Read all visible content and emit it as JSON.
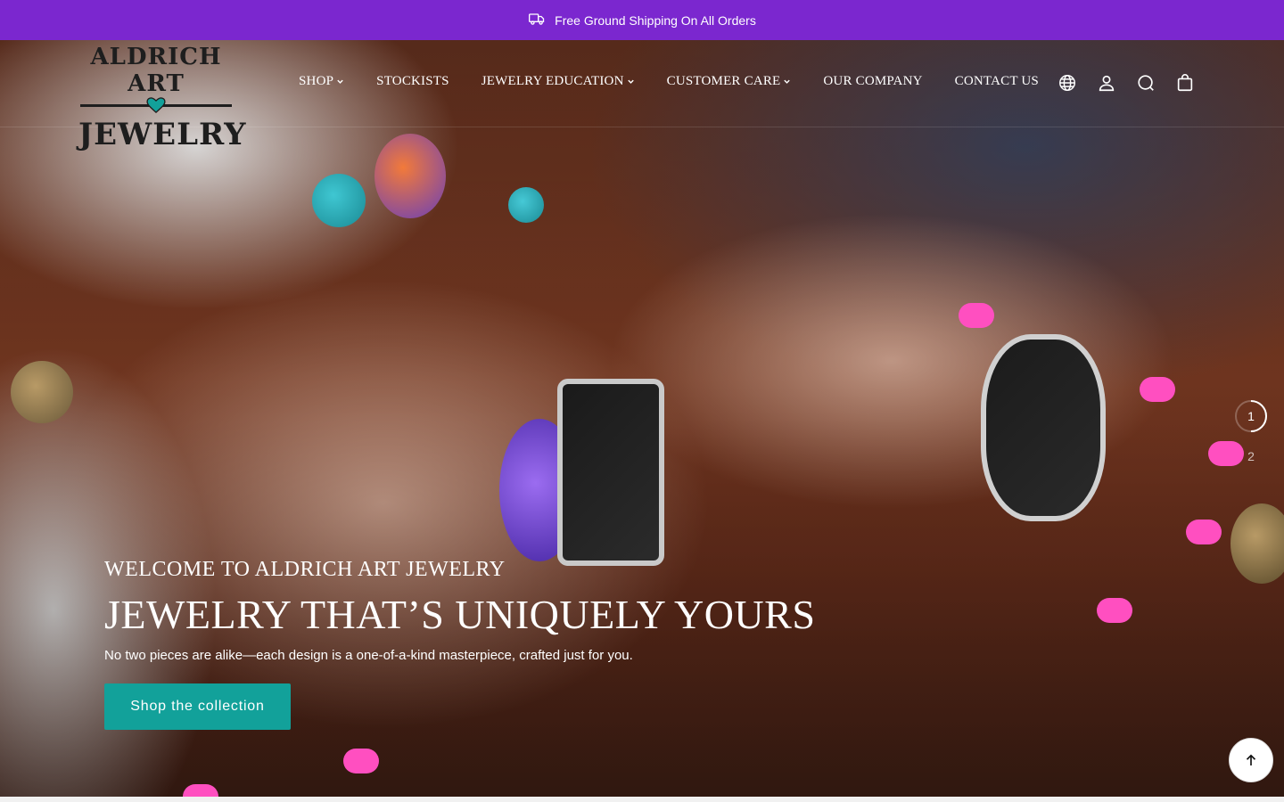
{
  "announcement": {
    "text": "Free Ground Shipping On All Orders",
    "icon": "truck-icon"
  },
  "brand": {
    "logo_line1": "ALDRICH ART",
    "logo_line2": "JEWELRY",
    "accent": "#12a19a"
  },
  "nav": {
    "items": [
      {
        "label": "SHOP",
        "dropdown": true
      },
      {
        "label": "STOCKISTS",
        "dropdown": false
      },
      {
        "label": "JEWELRY EDUCATION",
        "dropdown": true
      },
      {
        "label": "CUSTOMER CARE",
        "dropdown": true
      },
      {
        "label": "OUR COMPANY",
        "dropdown": false
      },
      {
        "label": "CONTACT US",
        "dropdown": false
      }
    ]
  },
  "header_icons": [
    "globe-icon",
    "account-icon",
    "search-icon",
    "cart-icon"
  ],
  "hero": {
    "kicker": "WELCOME TO ALDRICH ART JEWELRY",
    "headline": "JEWELRY THAT’S UNIQUELY YOURS",
    "subtext": "No two pieces are alike—each design is a one-of-a-kind masterpiece, crafted just for you.",
    "cta_label": "Shop the collection"
  },
  "pager": {
    "current": "1",
    "next": "2"
  },
  "colors": {
    "announcement_bg": "#7b27cf",
    "cta_bg": "#12a19a"
  }
}
